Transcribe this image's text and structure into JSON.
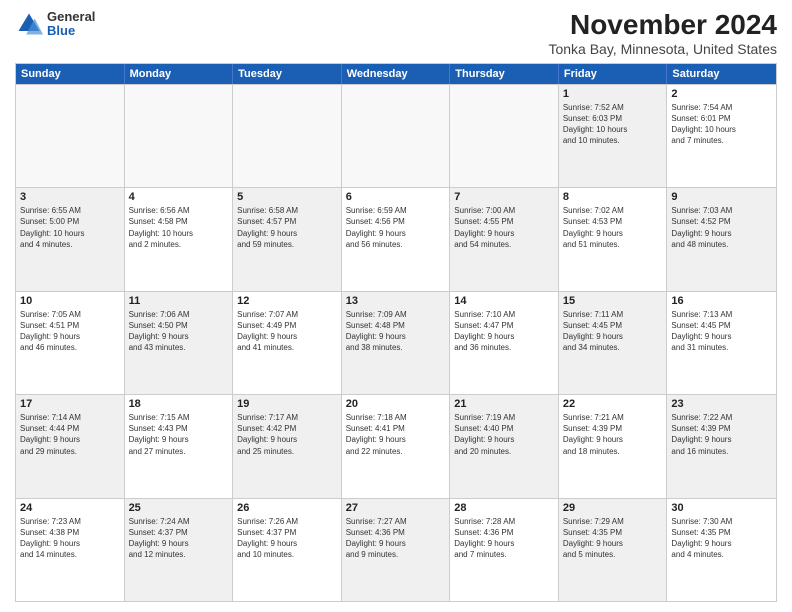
{
  "logo": {
    "general": "General",
    "blue": "Blue"
  },
  "title": "November 2024",
  "subtitle": "Tonka Bay, Minnesota, United States",
  "days": [
    "Sunday",
    "Monday",
    "Tuesday",
    "Wednesday",
    "Thursday",
    "Friday",
    "Saturday"
  ],
  "rows": [
    [
      {
        "day": "",
        "info": "",
        "empty": true
      },
      {
        "day": "",
        "info": "",
        "empty": true
      },
      {
        "day": "",
        "info": "",
        "empty": true
      },
      {
        "day": "",
        "info": "",
        "empty": true
      },
      {
        "day": "",
        "info": "",
        "empty": true
      },
      {
        "day": "1",
        "info": "Sunrise: 7:52 AM\nSunset: 6:03 PM\nDaylight: 10 hours\nand 10 minutes.",
        "shaded": true
      },
      {
        "day": "2",
        "info": "Sunrise: 7:54 AM\nSunset: 6:01 PM\nDaylight: 10 hours\nand 7 minutes.",
        "shaded": false
      }
    ],
    [
      {
        "day": "3",
        "info": "Sunrise: 6:55 AM\nSunset: 5:00 PM\nDaylight: 10 hours\nand 4 minutes.",
        "shaded": true
      },
      {
        "day": "4",
        "info": "Sunrise: 6:56 AM\nSunset: 4:58 PM\nDaylight: 10 hours\nand 2 minutes.",
        "shaded": false
      },
      {
        "day": "5",
        "info": "Sunrise: 6:58 AM\nSunset: 4:57 PM\nDaylight: 9 hours\nand 59 minutes.",
        "shaded": true
      },
      {
        "day": "6",
        "info": "Sunrise: 6:59 AM\nSunset: 4:56 PM\nDaylight: 9 hours\nand 56 minutes.",
        "shaded": false
      },
      {
        "day": "7",
        "info": "Sunrise: 7:00 AM\nSunset: 4:55 PM\nDaylight: 9 hours\nand 54 minutes.",
        "shaded": true
      },
      {
        "day": "8",
        "info": "Sunrise: 7:02 AM\nSunset: 4:53 PM\nDaylight: 9 hours\nand 51 minutes.",
        "shaded": false
      },
      {
        "day": "9",
        "info": "Sunrise: 7:03 AM\nSunset: 4:52 PM\nDaylight: 9 hours\nand 48 minutes.",
        "shaded": true
      }
    ],
    [
      {
        "day": "10",
        "info": "Sunrise: 7:05 AM\nSunset: 4:51 PM\nDaylight: 9 hours\nand 46 minutes.",
        "shaded": false
      },
      {
        "day": "11",
        "info": "Sunrise: 7:06 AM\nSunset: 4:50 PM\nDaylight: 9 hours\nand 43 minutes.",
        "shaded": true
      },
      {
        "day": "12",
        "info": "Sunrise: 7:07 AM\nSunset: 4:49 PM\nDaylight: 9 hours\nand 41 minutes.",
        "shaded": false
      },
      {
        "day": "13",
        "info": "Sunrise: 7:09 AM\nSunset: 4:48 PM\nDaylight: 9 hours\nand 38 minutes.",
        "shaded": true
      },
      {
        "day": "14",
        "info": "Sunrise: 7:10 AM\nSunset: 4:47 PM\nDaylight: 9 hours\nand 36 minutes.",
        "shaded": false
      },
      {
        "day": "15",
        "info": "Sunrise: 7:11 AM\nSunset: 4:45 PM\nDaylight: 9 hours\nand 34 minutes.",
        "shaded": true
      },
      {
        "day": "16",
        "info": "Sunrise: 7:13 AM\nSunset: 4:45 PM\nDaylight: 9 hours\nand 31 minutes.",
        "shaded": false
      }
    ],
    [
      {
        "day": "17",
        "info": "Sunrise: 7:14 AM\nSunset: 4:44 PM\nDaylight: 9 hours\nand 29 minutes.",
        "shaded": true
      },
      {
        "day": "18",
        "info": "Sunrise: 7:15 AM\nSunset: 4:43 PM\nDaylight: 9 hours\nand 27 minutes.",
        "shaded": false
      },
      {
        "day": "19",
        "info": "Sunrise: 7:17 AM\nSunset: 4:42 PM\nDaylight: 9 hours\nand 25 minutes.",
        "shaded": true
      },
      {
        "day": "20",
        "info": "Sunrise: 7:18 AM\nSunset: 4:41 PM\nDaylight: 9 hours\nand 22 minutes.",
        "shaded": false
      },
      {
        "day": "21",
        "info": "Sunrise: 7:19 AM\nSunset: 4:40 PM\nDaylight: 9 hours\nand 20 minutes.",
        "shaded": true
      },
      {
        "day": "22",
        "info": "Sunrise: 7:21 AM\nSunset: 4:39 PM\nDaylight: 9 hours\nand 18 minutes.",
        "shaded": false
      },
      {
        "day": "23",
        "info": "Sunrise: 7:22 AM\nSunset: 4:39 PM\nDaylight: 9 hours\nand 16 minutes.",
        "shaded": true
      }
    ],
    [
      {
        "day": "24",
        "info": "Sunrise: 7:23 AM\nSunset: 4:38 PM\nDaylight: 9 hours\nand 14 minutes.",
        "shaded": false
      },
      {
        "day": "25",
        "info": "Sunrise: 7:24 AM\nSunset: 4:37 PM\nDaylight: 9 hours\nand 12 minutes.",
        "shaded": true
      },
      {
        "day": "26",
        "info": "Sunrise: 7:26 AM\nSunset: 4:37 PM\nDaylight: 9 hours\nand 10 minutes.",
        "shaded": false
      },
      {
        "day": "27",
        "info": "Sunrise: 7:27 AM\nSunset: 4:36 PM\nDaylight: 9 hours\nand 9 minutes.",
        "shaded": true
      },
      {
        "day": "28",
        "info": "Sunrise: 7:28 AM\nSunset: 4:36 PM\nDaylight: 9 hours\nand 7 minutes.",
        "shaded": false
      },
      {
        "day": "29",
        "info": "Sunrise: 7:29 AM\nSunset: 4:35 PM\nDaylight: 9 hours\nand 5 minutes.",
        "shaded": true
      },
      {
        "day": "30",
        "info": "Sunrise: 7:30 AM\nSunset: 4:35 PM\nDaylight: 9 hours\nand 4 minutes.",
        "shaded": false
      }
    ]
  ]
}
